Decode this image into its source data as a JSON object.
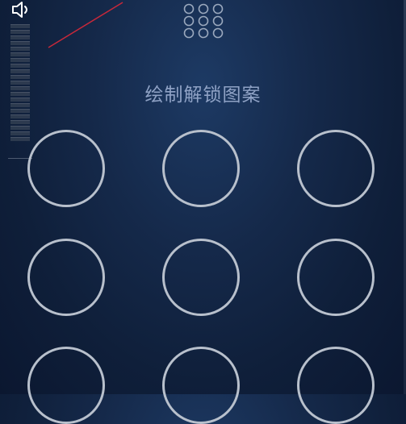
{
  "header": {
    "title": "绘制解锁图案"
  },
  "volume": {
    "icon": "speaker-icon",
    "segments": 21
  },
  "pattern": {
    "icon": "pattern-grid-icon",
    "nodes": [
      "node-1",
      "node-2",
      "node-3",
      "node-4",
      "node-5",
      "node-6",
      "node-7",
      "node-8",
      "node-9"
    ]
  },
  "colors": {
    "background": "#14284a",
    "title_text": "#8fa2c5",
    "node_ring": "#b8c0cc",
    "stroke": "#c8283a"
  }
}
